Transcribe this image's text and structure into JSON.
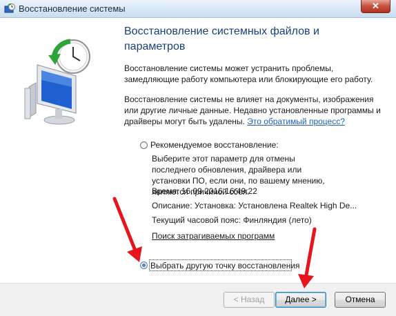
{
  "window": {
    "title": "Восстановление системы",
    "close_label": "✕"
  },
  "heading": "Восстановление системных файлов и параметров",
  "intro": "Восстановление системы может устранить проблемы, замедляющие работу компьютера или блокирующие его работу.",
  "note": {
    "text": "Восстановление системы не влияет на документы, изображения или другие личные данные. Недавно установленные программы и драйверы могут быть удалены.",
    "link": "Это обратимый процесс?"
  },
  "option_recommended": {
    "label": "Рекомендуемое восстановление:",
    "selected": false,
    "description": "Выберите этот параметр для отмены последнего обновления, драйвера или установки ПО, если они, по вашему мнению, являются причиной сбоя.",
    "time": "Время: 16.09.2016 16:49:22",
    "desc_line": "Описание: Установка: Установлена Realtek High De...",
    "timezone": "Текущий часовой пояс: Финляндия (лето)"
  },
  "affected_link": "Поиск затрагиваемых программ",
  "option_other": {
    "label": "Выбрать другую точку восстановления",
    "selected": true
  },
  "buttons": {
    "back": "< Назад",
    "next": "Далее >",
    "cancel": "Отмена"
  },
  "colors": {
    "heading": "#17407a",
    "link": "#1f5fb5",
    "annotation_arrow": "#e8141c"
  }
}
